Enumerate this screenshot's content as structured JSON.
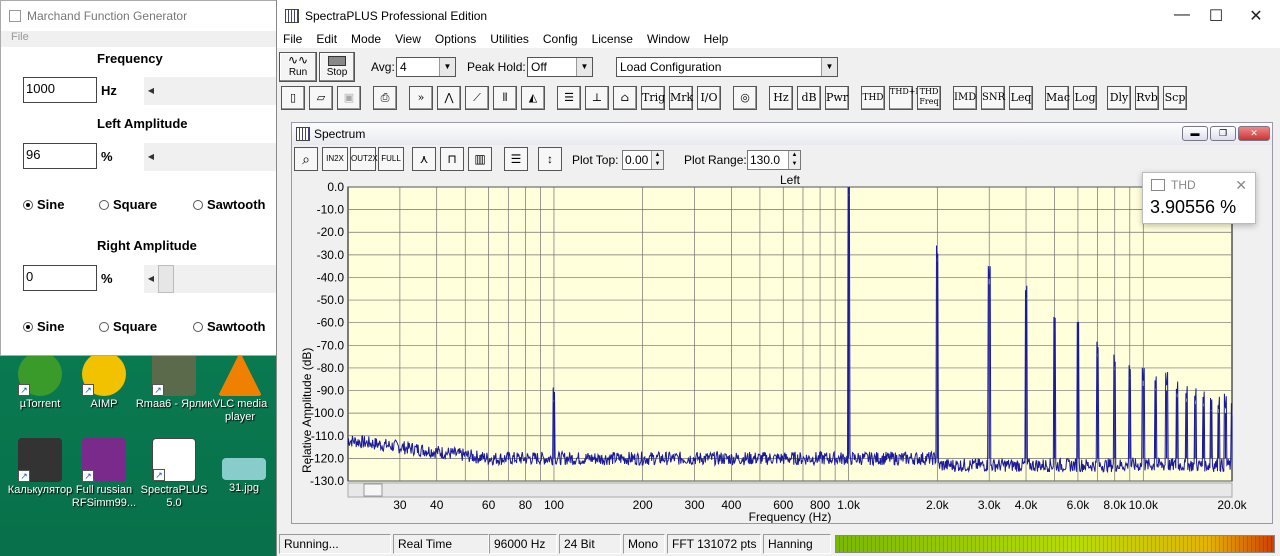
{
  "generator": {
    "title": "Marchand Function Generator",
    "menu": "File",
    "frequency_label": "Frequency",
    "frequency_value": "1000",
    "frequency_unit": "Hz",
    "left_label": "Left Amplitude",
    "left_value": "96",
    "left_unit": "%",
    "right_label": "Right Amplitude",
    "right_value": "0",
    "right_unit": "%",
    "waves": [
      "Sine",
      "Square",
      "Sawtooth"
    ],
    "left_wave": "Sine",
    "right_wave": "Sine"
  },
  "desktop": {
    "icons": [
      {
        "label": "µTorrent"
      },
      {
        "label": "AIMP"
      },
      {
        "label": "Rmaa6 - Ярлик"
      },
      {
        "label": "VLC media player"
      },
      {
        "label": "Калькулятор"
      },
      {
        "label": "Full russian RFSimm99..."
      },
      {
        "label": "SpectraPLUS 5.0"
      },
      {
        "label": "31.jpg"
      }
    ]
  },
  "spectra": {
    "title": "SpectraPLUS Professional Edition",
    "menu": [
      "File",
      "Edit",
      "Mode",
      "View",
      "Options",
      "Utilities",
      "Config",
      "License",
      "Window",
      "Help"
    ],
    "run_label": "Run",
    "stop_label": "Stop",
    "avg_label": "Avg:",
    "avg_value": "4",
    "peak_label": "Peak Hold:",
    "peak_value": "Off",
    "config_value": "Load Configuration",
    "tool_buttons": [
      "Trig",
      "Mrk",
      "I/O",
      "Hz",
      "dB",
      "Pwr",
      "THD",
      "THD+N",
      "THD Freq",
      "IMD",
      "SNR",
      "Leq",
      "Mac",
      "Log",
      "Dly",
      "Rvb",
      "Scp"
    ],
    "child_title": "Spectrum",
    "plot_top_label": "Plot Top:",
    "plot_top_value": "0.00",
    "plot_range_label": "Plot Range:",
    "plot_range_value": "130.0"
  },
  "thd_popup": {
    "title": "THD",
    "value": "3.90556 %"
  },
  "status": {
    "state": "Running...",
    "mode": "Real Time",
    "rate": "96000 Hz",
    "bits": "24 Bit",
    "channels": "Mono",
    "fft": "FFT 131072 pts",
    "window": "Hanning"
  },
  "chart_data": {
    "type": "line",
    "title": "Left",
    "xlabel": "Frequency (Hz)",
    "ylabel": "Relative Amplitude (dB)",
    "x_scale": "log",
    "xlim": [
      20,
      20000
    ],
    "ylim": [
      -130,
      0
    ],
    "x_ticks": [
      30,
      40,
      60,
      80,
      100,
      200,
      300,
      400,
      600,
      800,
      1000,
      2000,
      3000,
      4000,
      6000,
      8000,
      10000,
      20000
    ],
    "x_tick_labels": [
      "30",
      "40",
      "60",
      "80",
      "100",
      "200",
      "300",
      "400",
      "600",
      "800",
      "1.0k",
      "2.0k",
      "3.0k",
      "4.0k",
      "6.0k",
      "8.0k",
      "10.0k",
      "20.0k"
    ],
    "y_ticks": [
      0,
      -10,
      -20,
      -30,
      -40,
      -50,
      -60,
      -70,
      -80,
      -90,
      -100,
      -110,
      -120,
      -130
    ],
    "y_tick_labels": [
      "0.0",
      "-10.0",
      "-20.0",
      "-30.0",
      "-40.0",
      "-50.0",
      "-60.0",
      "-70.0",
      "-80.0",
      "-90.0",
      "-100.0",
      "-110.0",
      "-120.0",
      "-130.0"
    ],
    "grid": true,
    "noise_floor_db": -120,
    "peaks": [
      {
        "x": 100,
        "y": -95
      },
      {
        "x": 1000,
        "y": -4
      },
      {
        "x": 2000,
        "y": -33
      },
      {
        "x": 3000,
        "y": -43
      },
      {
        "x": 4000,
        "y": -50
      },
      {
        "x": 5000,
        "y": -63
      },
      {
        "x": 6000,
        "y": -65
      },
      {
        "x": 7000,
        "y": -75
      },
      {
        "x": 8000,
        "y": -81
      },
      {
        "x": 9000,
        "y": -85
      },
      {
        "x": 10000,
        "y": -88
      },
      {
        "x": 11000,
        "y": -90
      },
      {
        "x": 12000,
        "y": -90
      },
      {
        "x": 13000,
        "y": -93
      },
      {
        "x": 14000,
        "y": -95
      },
      {
        "x": 15000,
        "y": -96
      },
      {
        "x": 16000,
        "y": -97
      },
      {
        "x": 17000,
        "y": -99
      },
      {
        "x": 18000,
        "y": -100
      },
      {
        "x": 19000,
        "y": -100
      },
      {
        "x": 20000,
        "y": -101
      }
    ],
    "line_color": "#1a1a9c",
    "background_color": "#ffffdc"
  }
}
